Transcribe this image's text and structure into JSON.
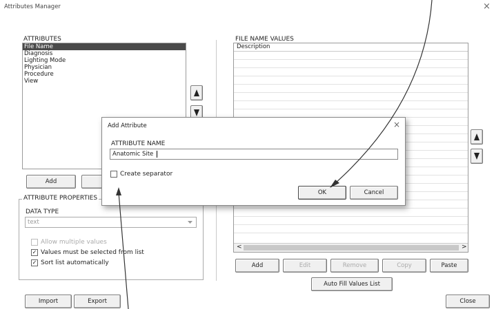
{
  "window": {
    "title": "Attributes Manager",
    "close_glyph": "×"
  },
  "attributes": {
    "label": "ATTRIBUTES",
    "items": [
      "File Name",
      "Diagnosis",
      "Lighting Mode",
      "Physician",
      "Procedure",
      "View"
    ],
    "selected_index": 0,
    "add_label": "Add"
  },
  "attribute_properties": {
    "label": "ATTRIBUTE PROPERTIES",
    "data_type_label": "DATA TYPE",
    "data_type_value": "text",
    "allow_multiple_label": "Allow multiple values",
    "allow_multiple_checked": false,
    "values_from_list_label": "Values must be selected from list",
    "values_from_list_checked": true,
    "sort_list_label": "Sort list automatically",
    "sort_list_checked": true
  },
  "bottom_buttons": {
    "import_label": "Import",
    "export_label": "Export",
    "close_label": "Close"
  },
  "file_name_values": {
    "label": "FILE NAME VALUES",
    "column_header": "Description",
    "row_count": 22,
    "scroll_left": "<",
    "scroll_right": ">",
    "buttons": {
      "add": "Add",
      "edit": "Edit",
      "remove": "Remove",
      "copy": "Copy",
      "paste": "Paste",
      "auto_fill": "Auto Fill Values List"
    }
  },
  "add_attribute_dialog": {
    "title": "Add Attribute",
    "close_glyph": "×",
    "name_label": "ATTRIBUTE NAME",
    "name_value": "Anatomic Site",
    "separator_label": "Create separator",
    "separator_checked": false,
    "ok_label": "OK",
    "cancel_label": "Cancel"
  },
  "annotations": {
    "arrow_color": "#333333"
  }
}
